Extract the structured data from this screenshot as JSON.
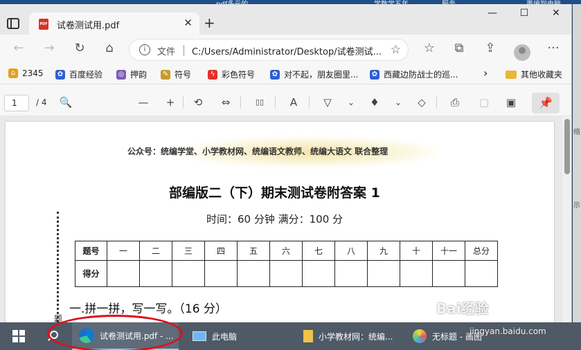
{
  "background_strip": [
    "pdf多元的...",
    "学数学五年...",
    "服务",
    "再编到电脑"
  ],
  "window": {
    "tab_title": "试卷测试用.pdf",
    "pdf_badge": "PDF",
    "tab_close": "✕",
    "new_tab": "+",
    "controls": [
      "—",
      "☐",
      "✕"
    ]
  },
  "toolbar": {
    "back": "←",
    "forward": "→",
    "refresh": "↻",
    "home": "⌂",
    "info": "i",
    "file_label": "文件",
    "url": "C:/Users/Administrator/Desktop/试卷测试...",
    "add_favorite": "☆",
    "favorites": "☆",
    "collections": "⧉",
    "share": "⇪",
    "more": "···"
  },
  "favorites": [
    {
      "label": "2345",
      "icon": "home-icon",
      "color": "#e6a11a"
    },
    {
      "label": "百度经验",
      "icon": "paw-icon",
      "color": "#2f5fd3"
    },
    {
      "label": "押韵",
      "icon": "rhyme-icon",
      "color": "#7a5ab8"
    },
    {
      "label": "符号",
      "icon": "pencil-icon",
      "color": "#c79a2a"
    },
    {
      "label": "彩色符号",
      "icon": "flash-icon",
      "color": "#e2312a"
    },
    {
      "label": "对不起，朋友圈里...",
      "icon": "paw-icon",
      "color": "#2f5fd3"
    },
    {
      "label": "西藏边防战士的巡...",
      "icon": "paw-icon",
      "color": "#2f5fd3"
    }
  ],
  "favorites_more": "›",
  "other_favorites": "其他收藏夹",
  "pdf_toolbar": {
    "page_current": "1",
    "page_total": "/ 4",
    "icons": [
      "🔍",
      "—",
      "+",
      "⟲",
      "⇔",
      "▯▯",
      "A",
      "▽",
      "⌄",
      "♦",
      "⌄",
      "◇",
      "⎙",
      "▢",
      "▣"
    ],
    "pin": "📌"
  },
  "document": {
    "source_line": "公众号：统编学堂、小学教材网、统编语文教师、统编大语文 联合整理",
    "title": "部编版二（下）期末测试卷附答案 1",
    "subtitle": "时间：60 分钟    满分：100 分",
    "side_char": "题",
    "score_table": {
      "header": [
        "题号",
        "一",
        "二",
        "三",
        "四",
        "五",
        "六",
        "七",
        "八",
        "九",
        "十",
        "十一",
        "总分"
      ],
      "row_label": "得分"
    },
    "section_heading": "一.拼一拼，写一写。（16 分）"
  },
  "right_edge": [
    "络",
    "示"
  ],
  "taskbar": {
    "items": [
      {
        "label": "试卷测试用.pdf - ...",
        "active": true
      },
      {
        "label": "此电脑",
        "active": false
      },
      {
        "label": "小学教材网：统编...",
        "active": false
      },
      {
        "label": "无标题 - 画图",
        "active": false
      }
    ]
  },
  "watermark": {
    "main": "Bai经验",
    "sub": "jingyan.baidu.com"
  }
}
